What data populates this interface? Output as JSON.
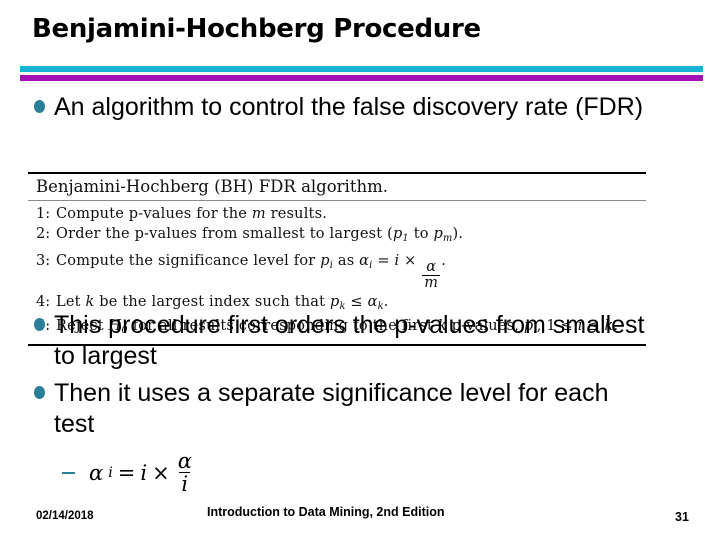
{
  "slide": {
    "title": "Benjamini-Hochberg Procedure",
    "divider": {
      "cyan_color": "#16b3d2",
      "purple_color": "#a313b4"
    },
    "bullet_color": "#2a7f97"
  },
  "bullets": [
    {
      "text": "An algorithm to control the false discovery rate (FDR)"
    },
    {
      "text": "This procedure first orders the p-values from smallest to largest"
    },
    {
      "text": "Then it uses a separate significance level for each test"
    }
  ],
  "sub_bullet": {
    "marker": "dash-marker",
    "alpha": "α",
    "subscript": "i",
    "equals": "=",
    "factor": "i",
    "times": "×",
    "frac_num": "α",
    "frac_den": "i"
  },
  "algorithm": {
    "title": "Benjamini-Hochberg (BH) FDR algorithm.",
    "steps": [
      {
        "number": "1:",
        "parts": [
          {
            "t": "Compute  p-values  for the ",
            "style": "plain"
          },
          {
            "t": "m",
            "style": "italic"
          },
          {
            "t": " results.",
            "style": "plain"
          }
        ]
      },
      {
        "number": "2:",
        "parts": [
          {
            "t": "Order  the  p-values  from  smallest  to  largest  (",
            "style": "plain"
          },
          {
            "t": "p",
            "style": "italic"
          },
          {
            "t": "1",
            "style": "sub"
          },
          {
            "t": " to ",
            "style": "plain"
          },
          {
            "t": "p",
            "style": "italic"
          },
          {
            "t": "m",
            "style": "sub"
          },
          {
            "t": ").",
            "style": "plain"
          }
        ]
      },
      {
        "number": "3:",
        "parts": [
          {
            "t": "Compute  the  significance  level  for ",
            "style": "plain"
          },
          {
            "t": "p",
            "style": "italic"
          },
          {
            "t": "i",
            "style": "sub"
          },
          {
            "t": " as ",
            "style": "plain"
          },
          {
            "t": "α",
            "style": "italic"
          },
          {
            "t": "i",
            "style": "sub"
          },
          {
            "t": " = ",
            "style": "plain"
          },
          {
            "t": "i",
            "style": "italic"
          },
          {
            "t": " × ",
            "style": "plain"
          },
          {
            "t": "α/m",
            "style": "frac"
          },
          {
            "t": ".",
            "style": "plain"
          }
        ]
      },
      {
        "number": "4:",
        "parts": [
          {
            "t": "Let ",
            "style": "plain"
          },
          {
            "t": "k",
            "style": "italic"
          },
          {
            "t": " be the  largest  index  such  that ",
            "style": "plain"
          },
          {
            "t": "p",
            "style": "italic"
          },
          {
            "t": "k",
            "style": "sub"
          },
          {
            "t": " ≤ ",
            "style": "plain"
          },
          {
            "t": "α",
            "style": "italic"
          },
          {
            "t": "k",
            "style": "sub"
          },
          {
            "t": ".",
            "style": "plain"
          }
        ]
      },
      {
        "number": "5:",
        "parts": [
          {
            "t": "Reject ",
            "style": "plain"
          },
          {
            "t": "H",
            "style": "italic"
          },
          {
            "t": "0",
            "style": "sub"
          },
          {
            "t": " for all results  corresponding  to  the  first ",
            "style": "plain"
          },
          {
            "t": "k",
            "style": "italic"
          },
          {
            "t": " p-values, ",
            "style": "plain"
          },
          {
            "t": "p",
            "style": "italic"
          },
          {
            "t": "i",
            "style": "sub"
          },
          {
            "t": ", 1 ≤ ",
            "style": "plain"
          },
          {
            "t": "i",
            "style": "italic"
          },
          {
            "t": " ≤ ",
            "style": "plain"
          },
          {
            "t": "k",
            "style": "italic"
          },
          {
            "t": ".",
            "style": "plain"
          }
        ]
      }
    ]
  },
  "footer": {
    "date": "02/14/2018",
    "center": "Introduction to Data Mining, 2nd Edition",
    "page": "31"
  }
}
